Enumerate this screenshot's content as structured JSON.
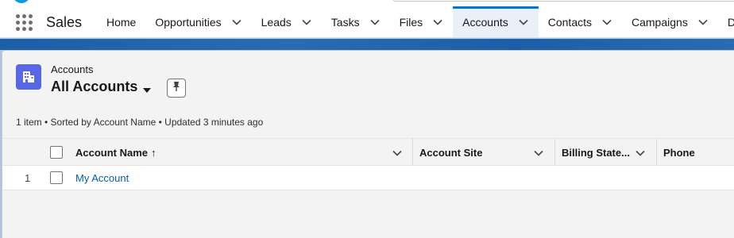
{
  "app": {
    "name": "Sales"
  },
  "nav": {
    "tabs": [
      {
        "label": "Home",
        "has_menu": false,
        "active": false
      },
      {
        "label": "Opportunities",
        "has_menu": true,
        "active": false
      },
      {
        "label": "Leads",
        "has_menu": true,
        "active": false
      },
      {
        "label": "Tasks",
        "has_menu": true,
        "active": false
      },
      {
        "label": "Files",
        "has_menu": true,
        "active": false
      },
      {
        "label": "Accounts",
        "has_menu": true,
        "active": true
      },
      {
        "label": "Contacts",
        "has_menu": true,
        "active": false
      },
      {
        "label": "Campaigns",
        "has_menu": true,
        "active": false
      },
      {
        "label": "Dashboa",
        "has_menu": false,
        "active": false
      }
    ]
  },
  "header": {
    "object_label": "Accounts",
    "view_title": "All Accounts",
    "icons": {
      "object": "account-building-icon",
      "pin": "pin-icon",
      "view_menu": "caret-down-icon"
    }
  },
  "list_meta": "1 item • Sorted by Account Name • Updated 3 minutes ago",
  "table": {
    "columns": [
      {
        "label": "Account Name",
        "sort": "ascending"
      },
      {
        "label": "Account Site"
      },
      {
        "label": "Billing State..."
      },
      {
        "label": "Phone"
      }
    ],
    "sort_indicator": "↑",
    "rows": [
      {
        "num": "1",
        "account_name": "My Account",
        "account_site": "",
        "billing_state": "",
        "phone": ""
      }
    ]
  },
  "colors": {
    "accent": "#0176d3",
    "active_tab_bg": "#ebeffa",
    "object_icon": "#5867e8",
    "link": "#0b5cab"
  }
}
